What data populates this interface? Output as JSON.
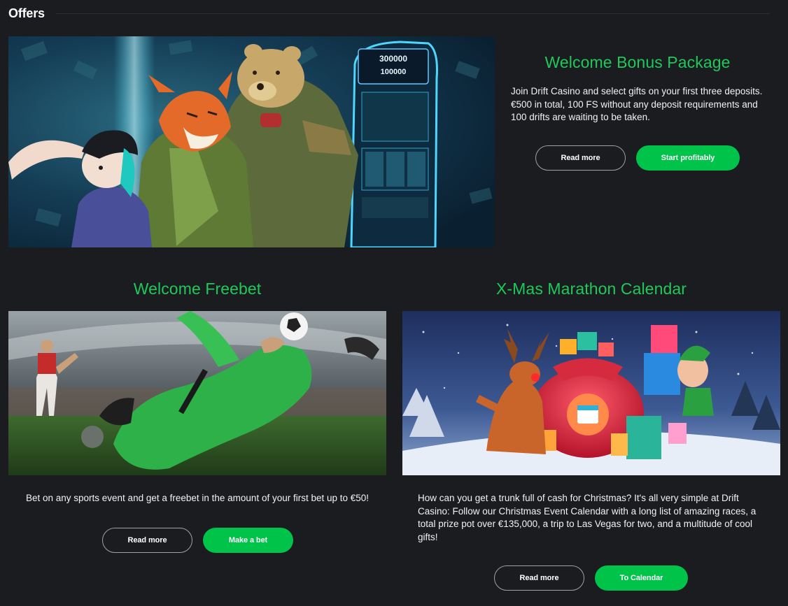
{
  "page": {
    "title": "Offers"
  },
  "offers": [
    {
      "title": "Welcome Bonus Package",
      "description": "Join Drift Casino and select gifts on your first three deposits. €500 in total, 100 FS without any deposit requirements and 100 drifts are waiting to be taken.",
      "secondary_label": "Read more",
      "primary_label": "Start profitably",
      "image_icon": "casino-mascots-image",
      "slot_display": [
        "300000",
        "100000"
      ]
    },
    {
      "title": "Welcome Freebet",
      "description": "Bet on any sports event and get a freebet in the amount of your first bet up to €50!",
      "secondary_label": "Read more",
      "primary_label": "Make a bet",
      "image_icon": "football-goalkeeper-image"
    },
    {
      "title": "X-Mas Marathon Calendar",
      "description": "How can you get a trunk full of cash for Christmas? It's all very simple at Drift Casino: Follow our Christmas Event Calendar with a long list of amazing races, a total prize pot over €135,000, a trip to Las Vegas for two, and a multitude of cool gifts!",
      "secondary_label": "Read more",
      "primary_label": "To Calendar",
      "image_icon": "christmas-gifts-image"
    }
  ],
  "colors": {
    "background": "#1b1c20",
    "accent_green": "#00c34a",
    "title_green": "#1ec95a",
    "outline": "#9fa1a7"
  }
}
